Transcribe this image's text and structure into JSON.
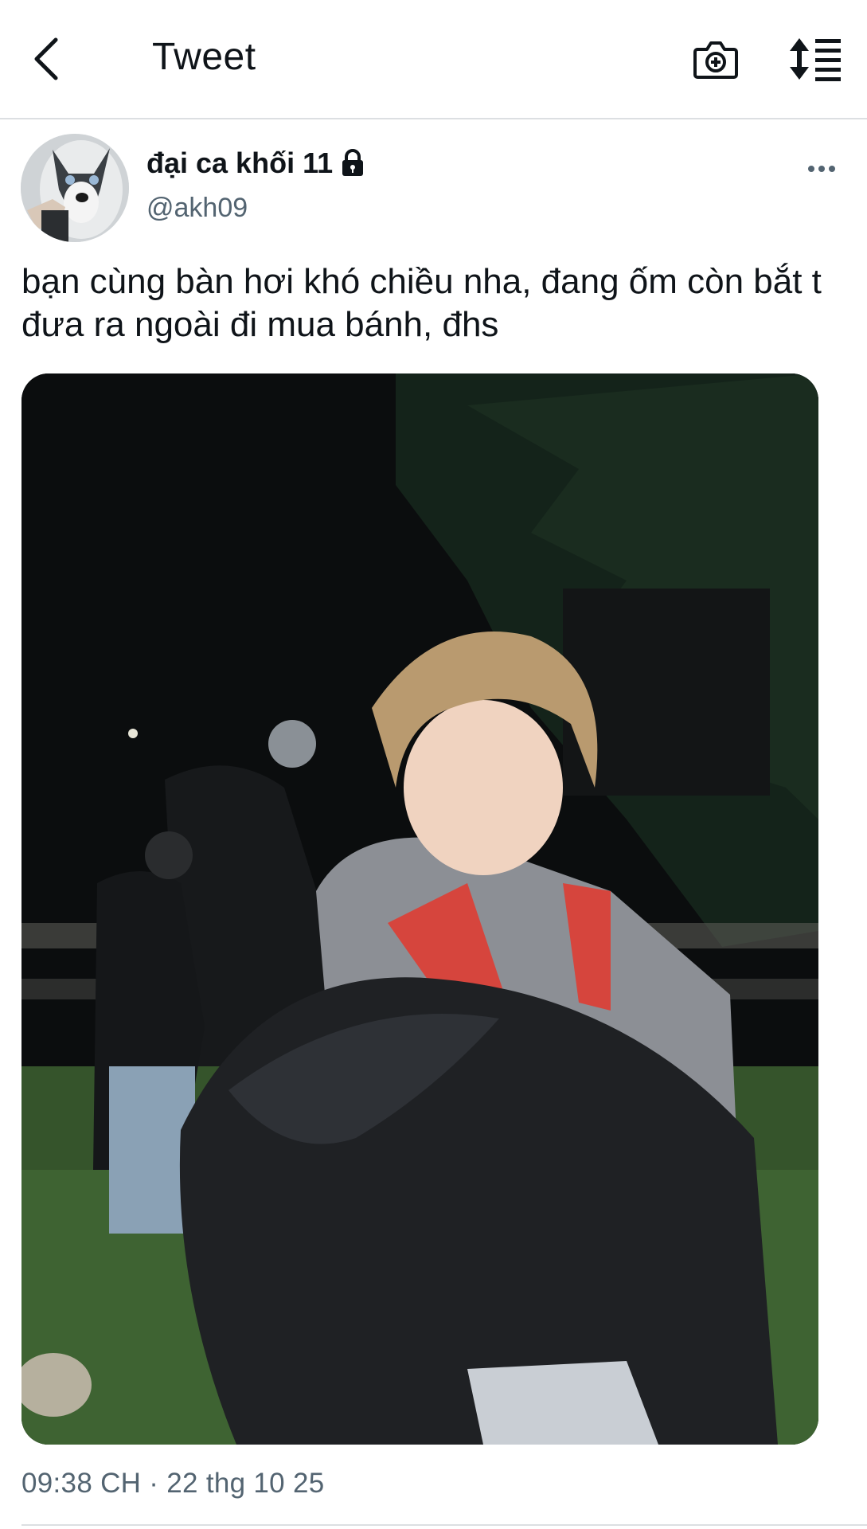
{
  "header": {
    "title": "Tweet",
    "back_icon": "back-arrow-icon",
    "camera_icon": "camera-add-icon",
    "sort_icon": "sort-list-icon"
  },
  "tweet": {
    "author_name": "đại ca khối 11",
    "author_handle": "@akh09",
    "author_locked_icon": "lock-icon",
    "more_icon": "more-horizontal-icon",
    "text": "bạn cùng bàn hơi khó chiều nha, đang ốm còn bắt t đưa ra ngoài đi mua bánh, đhs",
    "timestamp": "09:38 CH · 22 thg 10 25"
  },
  "colors": {
    "text_primary": "#0f1419",
    "text_secondary": "#536471",
    "divider": "#dcdfe2"
  }
}
